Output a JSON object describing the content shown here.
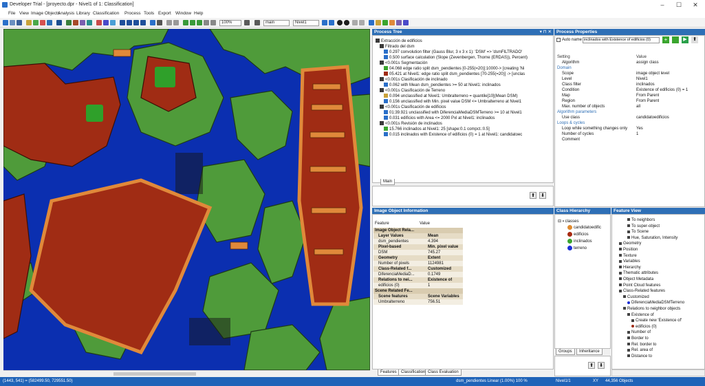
{
  "title_bar": {
    "title": "Developer Trial - [proyecto.dpr - Nivel1 of 1: Classification]",
    "minimize": "–",
    "maximize": "☐",
    "close": "✕"
  },
  "menu": [
    "File",
    "View",
    "Image Objects",
    "Analysis",
    "Library",
    "Classification",
    "Process",
    "Tools",
    "Export",
    "Window",
    "Help"
  ],
  "toolbar": {
    "zoom": "100%",
    "layer": "main",
    "level": "Nivel1"
  },
  "process_tree": {
    "header": "Process Tree",
    "rows": [
      "Extracción de edificios",
      "Filtrado del dsm",
      "0.297   convolution filter (Gauss Blur, 3 x 3 x 1): 'DSM' => 'dsmFILTRADO'",
      "0.500   surface calculation (Slope (Zevenbergen, Thorne (ERDAS)), Percent)",
      "<0.001s   Segmentación",
      "04.068   edge ratio split dsm_pendientes [0-255(=20)]:10000-> [creating 'Ni",
      "05.421   at  Nivel1: edge ratio split dsm_pendientes [70-255(=20)] -> [unclas",
      "<0.001s   Clasificación de inclinado",
      "0.062   with Mean dsm_pendientes >= 50  at  Nivel1: inclinados",
      "<0.001s   Clasificación de Terreno",
      "0.094   unclassified  at  Nivel1: Umbralterreno = quantile[10](Mean DSM)",
      "0.156   unclassified with Min. pixel value DSM <= Umbralterreno at  Nivel1",
      "<0.001s   Clasificación de edificios",
      "01:39.921   unclassified with DiferenciaMediaDSMTerreno >= 10  at  Nivel1",
      "0.031   edificios with Area <= 2000 Pxl at  Nivel1: inclinados",
      "<0.001s   Revisión de inclinados",
      "15.766   inclinados  at  Nivel1: 25 [shape:0.1 compct.:0.5]",
      "0.015   inclinados with Existence of edificios (0) = 1  at  Nivel1: candidatoec"
    ],
    "tab": "Main"
  },
  "process_properties": {
    "header": "Process Properties",
    "auto_name_label": "Auto name",
    "auto_name_value": "inclinados with Existence of edificios (0)",
    "col_setting": "Setting",
    "col_value": "Value",
    "rows": [
      [
        "Algorithm",
        "assign class"
      ],
      [
        "Domain",
        ""
      ],
      [
        "Scope",
        "image object level"
      ],
      [
        "Level",
        "Nivel1"
      ],
      [
        "Class filter",
        "inclinados"
      ],
      [
        "Condition",
        "Existence of edificios (0) = 1"
      ],
      [
        "Map",
        "From Parent"
      ],
      [
        "Region",
        "From Parent"
      ],
      [
        "Max. number of objects",
        "all"
      ],
      [
        "Algorithm parameters",
        ""
      ],
      [
        "Use class",
        "candidatoedificios"
      ],
      [
        "Loops & cycles",
        ""
      ],
      [
        "Loop while something changes only",
        "Yes"
      ],
      [
        "Number of cycles",
        "1"
      ],
      [
        "Comment",
        ""
      ]
    ]
  },
  "image_object_info": {
    "header": "Image Object Information",
    "col_feature": "Feature",
    "col_value": "Value",
    "rows": [
      [
        "Image Object Rela...",
        ""
      ],
      [
        "Layer Values",
        "Mean"
      ],
      [
        "dsm_pendientes",
        "4.394"
      ],
      [
        "Pixel-based",
        "Min. pixel value"
      ],
      [
        "DSM",
        "745.27"
      ],
      [
        "Geometry",
        "Extent"
      ],
      [
        "Number of pixels",
        "1124981"
      ],
      [
        "Class-Related f...",
        "Customized"
      ],
      [
        "DiferenciaMediaD...",
        "0.1749"
      ],
      [
        "Relations to nei...",
        "Existence of"
      ],
      [
        "edificios (0)",
        "1"
      ],
      [
        "Scene Related Fe...",
        ""
      ],
      [
        "Scene features",
        "Scene Variables"
      ],
      [
        "Umbralterreno",
        "756.51"
      ]
    ],
    "tabs": [
      "Features",
      "Classification",
      "Class Evaluation"
    ]
  },
  "class_hierarchy": {
    "header": "Class Hierarchy",
    "root": "classes",
    "classes": [
      {
        "name": "candidatoedific",
        "color": "#e08a2e"
      },
      {
        "name": "edificios",
        "color": "#a82a12"
      },
      {
        "name": "inclinados",
        "color": "#3aa52e"
      },
      {
        "name": "terreno",
        "color": "#1c2fd6"
      }
    ],
    "tabs": [
      "Groups",
      "Inheritance"
    ]
  },
  "feature_view": {
    "header": "Feature View",
    "rows": [
      "To neighbors",
      "To super-object",
      "To Scene",
      "Hue, Saturation, Intensity",
      "Geometry",
      "Position",
      "Texture",
      "Variables",
      "Hierarchy",
      "Thematic attributes",
      "Object Metadata",
      "Point Cloud features",
      "Class-Related features",
      "Customized",
      "DiferenciaMediaDSMTerreno",
      "Relations to neighbor objects",
      "Existence of",
      "Create new 'Existence of'",
      "edificios (0)",
      "Number of",
      "Border to",
      "Rel. border to",
      "Rel. area of",
      "Distance to"
    ]
  },
  "status_bar": {
    "coords": "(1443, 541) = (582499.50, 729551.50)",
    "layer_info": "dsm_pendientes  Linear (1.00%)  100 %",
    "level": "Nivel1/1",
    "xy": "XY",
    "objects": "44,356 Objects"
  },
  "colors": {
    "terreno": "#0b2fb0",
    "edificios": "#a02c14",
    "inclinados": "#4f9b3a",
    "candidato": "#e0893a",
    "accent": "#2e6fb6"
  }
}
